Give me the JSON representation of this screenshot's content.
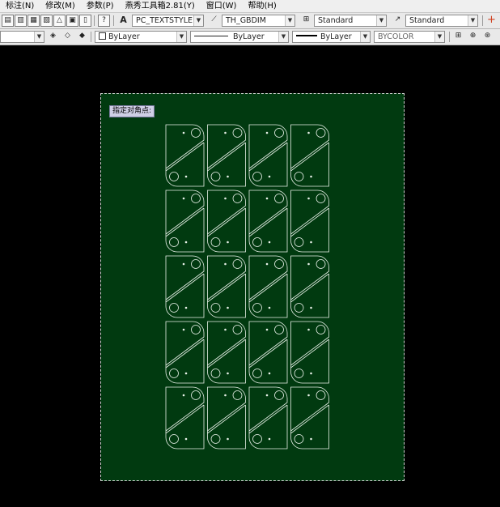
{
  "menu": {
    "items": [
      "标注(N)",
      "修改(M)",
      "参数(P)",
      "燕秀工具箱2.81(Y)",
      "窗口(W)",
      "帮助(H)"
    ]
  },
  "toolbar1": {
    "text_style": "PC_TEXTSTYLE",
    "dim_style": "TH_GBDIM",
    "table_style": "Standard",
    "multileader_style": "Standard"
  },
  "toolbar2": {
    "color": "ByLayer",
    "linetype": "ByLayer",
    "lineweight": "ByLayer",
    "plotstyle": "BYCOLOR"
  },
  "command": {
    "prompt": "指定对角点:"
  },
  "drawing": {
    "layout": "4 columns x 5 rows of bracket parts",
    "columns": 4,
    "rows": 5,
    "line_color": "#e8f0e8",
    "paper_color": "#013a10",
    "model_background": "#000000"
  },
  "colors": {
    "menu_bg": "#efefef",
    "toolbar_bg": "#e9e9e9"
  }
}
